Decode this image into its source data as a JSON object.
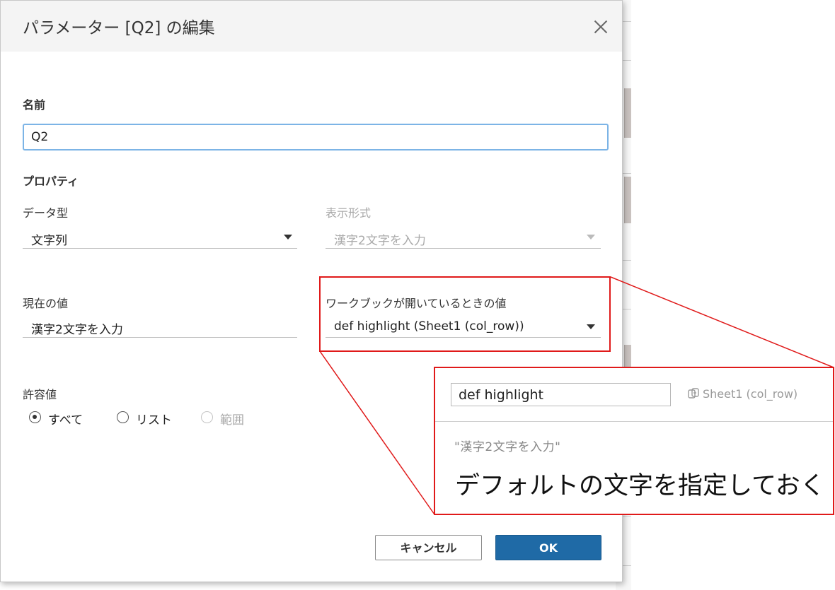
{
  "dialog": {
    "title": "パラメーター [Q2] の編集",
    "name_label": "名前",
    "name_value": "Q2",
    "properties_heading": "プロパティ",
    "data_type_label": "データ型",
    "data_type_value": "文字列",
    "display_format_label": "表示形式",
    "display_format_value": "漢字2文字を入力",
    "current_value_label": "現在の値",
    "current_value": "漢字2文字を入力",
    "workbook_open_label": "ワークブックが開いているときの値",
    "workbook_open_value": "def highlight (Sheet1 (col_row))",
    "allowable_label": "許容値",
    "allowable_options": [
      "すべて",
      "リスト",
      "範囲"
    ],
    "allowable_selected": "すべて",
    "cancel_label": "キャンセル",
    "ok_label": "OK"
  },
  "callout": {
    "field_value": "def highlight",
    "sheet_ref": "Sheet1 (col_row)",
    "default_text": "\"漢字2文字を入力\"",
    "note": "デフォルトの文字を指定しておく"
  },
  "colors": {
    "accent_blue": "#1f6aa6",
    "focus_border": "#7cb4e6",
    "annotation_red": "#e01a1a"
  }
}
